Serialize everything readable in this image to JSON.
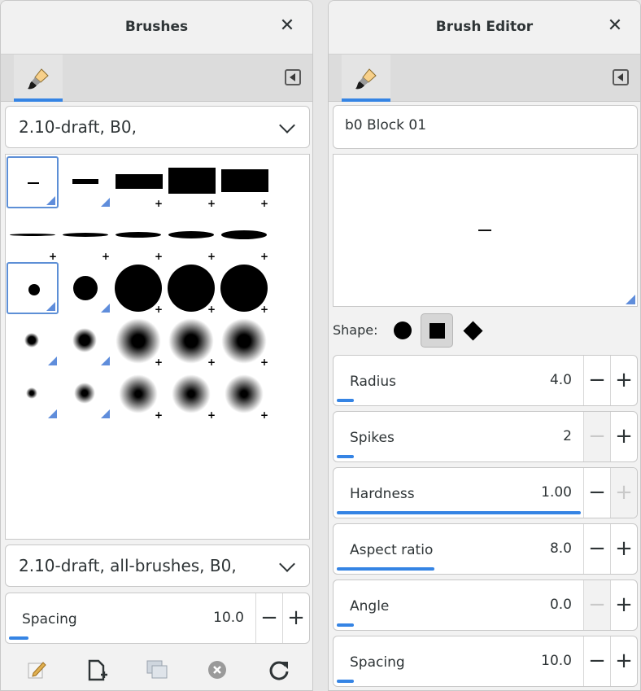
{
  "left_panel": {
    "title": "Brushes",
    "filter_combo": "2.10-draft, B0,",
    "preset_combo": "2.10-draft, all-brushes, B0,",
    "spacing": {
      "label": "Spacing",
      "value": "10.0",
      "fraction": 0.08
    }
  },
  "right_panel": {
    "title": "Brush Editor",
    "brush_name": "b0 Block 01",
    "shape_label": "Shape:",
    "params": [
      {
        "label": "Radius",
        "value": "4.0",
        "fraction": 0.07,
        "minus_disabled": false,
        "plus_disabled": false
      },
      {
        "label": "Spikes",
        "value": "2",
        "fraction": 0.07,
        "minus_disabled": true,
        "plus_disabled": false
      },
      {
        "label": "Hardness",
        "value": "1.00",
        "fraction": 1.0,
        "minus_disabled": false,
        "plus_disabled": true
      },
      {
        "label": "Aspect ratio",
        "value": "8.0",
        "fraction": 0.4,
        "minus_disabled": false,
        "plus_disabled": false
      },
      {
        "label": "Angle",
        "value": "0.0",
        "fraction": 0.07,
        "minus_disabled": true,
        "plus_disabled": false
      },
      {
        "label": "Spacing",
        "value": "10.0",
        "fraction": 0.07,
        "minus_disabled": false,
        "plus_disabled": false
      }
    ]
  },
  "colors": {
    "accent": "#3584e4",
    "corner_marker": "#5f8ddb"
  },
  "icons": [
    "paintbrush-icon",
    "tab-menu-icon",
    "close-icon",
    "chevron-down-icon",
    "edit-icon",
    "new-brush-icon",
    "duplicate-icon",
    "delete-icon",
    "refresh-icon",
    "circle-shape-icon",
    "square-shape-icon",
    "diamond-shape-icon"
  ]
}
